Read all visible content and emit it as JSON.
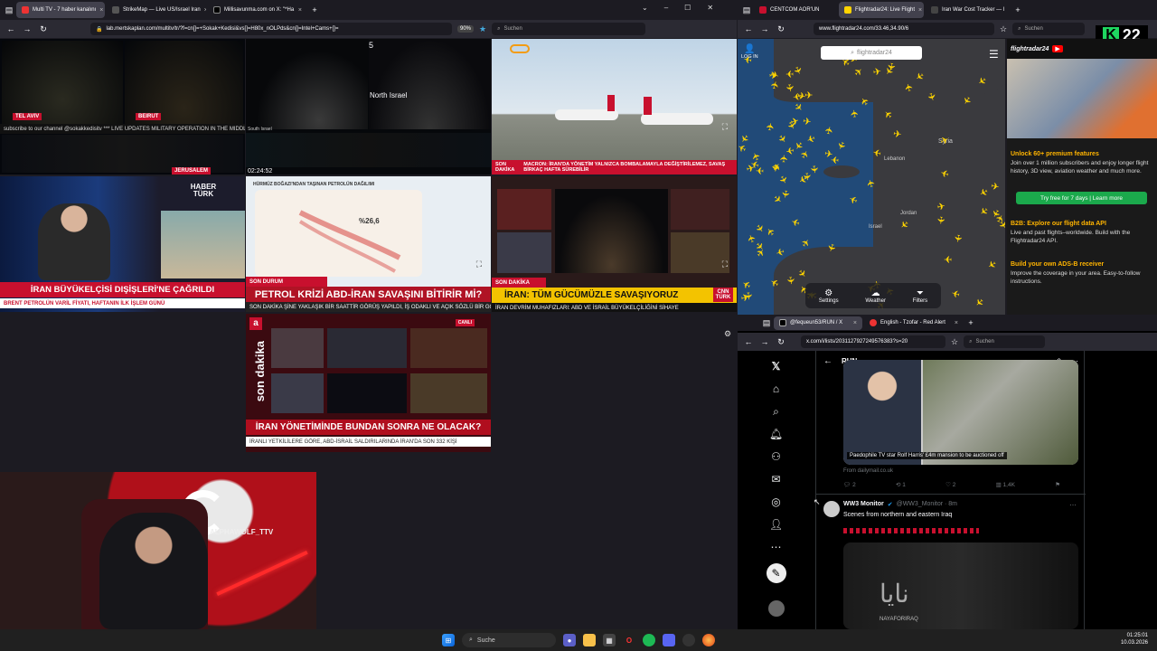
{
  "left_browser": {
    "tabs": [
      {
        "label": "Multi TV - 7 haber kanalını",
        "active": true
      },
      {
        "label": "StrikeMap — Live US/Israel Iran",
        "active": false
      },
      {
        "label": "Millisavunma.com on X: \"*Ha",
        "active": false
      }
    ],
    "url": "lab.mertskaplan.com/multitv/tr/?f=cn[]=+Sokak+Kedisi&vs[]=H80x_nOLPds&cn[]=Intel+Cams+[]=",
    "zoom": "90%",
    "search_placeholder": "Suchen"
  },
  "tiles": {
    "telaviv_label": "TEL AVIV",
    "beirut_label": "BEIRUT",
    "jerusalem_label": "JERUSALEM",
    "tiles_ticker": "subscribe to our channel @sokakkedisitv  *** LIVE UPDATES MILITARY OPERATION IN THE MIDDLE EAST",
    "north_israel": "North Israel",
    "south_israel": "South Israel",
    "cam_number": "5",
    "clock": "02:24:52",
    "ntv_ticker": "MACRON: İRAN'DA YÖNETİM YALNIZCA BOMBALAMAYLA DEĞİŞTİRİLEMEZ, SAVAŞ BİRKAÇ HAFTA SÜREBİLİR",
    "son_dakika": "SON DAKİKA",
    "haberturk_logo": "HABER TÜRK",
    "haberturk_headline": "İRAN BÜYÜKELÇİSİ DIŞİŞLERİ'NE ÇAĞRILDI",
    "haberturk_ticker": "BRENT PETROLÜN VARİL FİYATI, HAFTANIN İLK İŞLEM GÜNÜ",
    "map_title": "HÜRMÜZ BOĞAZI'NDAN TAŞINAN PETROLÜN DAĞILIMI",
    "map_percent": "%26,6",
    "son_durum": "SON DURUM",
    "petrol_headline": "PETROL KRİZİ ABD-İRAN SAVAŞINI BİTİRİR Mİ?",
    "petrol_ticker": "SON DAKİKA  ŞİNE YAKLAŞIK BİR SAATTİR GÖRÜŞ YAPILDI, İŞ ODAKLI VE AÇIK SÖZLÜ BİR GÖRÜŞME",
    "cnn_headline": "İRAN: TÜM GÜCÜMÜZLE SAVAŞIYORUZ",
    "cnn_logo": "CNN TÜRK",
    "cnn_ticker": "İRAN DEVRİM MUHAFIZLARI: ABD VE İSRAİL BÜYÜKELÇİLİĞİNİ SİHAYE",
    "canli": "CANLI",
    "a_haber_headline": "İRAN YÖNETİMİNDE BUNDAN SONRA NE OLACAK?",
    "a_haber_ticker": "İRANLI YETKİLİLERE GÖRE, ABD-İSRAİL SALDIRILARINDA İRAN'DA SON 332 KİŞİ",
    "son_dakika_side": "son dakika",
    "streamer_tag": "ALPHAWOLF_TTV"
  },
  "right_top_browser": {
    "tabs": [
      {
        "label": "CENTCOM AOR'UN",
        "active": false
      },
      {
        "label": "Flightradar24: Live Flight",
        "active": true
      },
      {
        "label": "Iran War Cost Tracker — l",
        "active": false
      }
    ],
    "url": "www.flightradar24.com/33.46,34.90/6",
    "search_placeholder": "Suchen",
    "login": "LOG IN",
    "fr24_search": "flightradar24",
    "map_labels": [
      "Syria",
      "Lebanon",
      "Israel",
      "Jordan"
    ],
    "bottom_buttons": [
      "Settings",
      "Weather",
      "Filters"
    ],
    "k22": "22",
    "promo": [
      {
        "title": "Unlock 60+ premium features",
        "text": "Join over 1 million subscribers and enjoy longer flight history, 3D view, aviation weather and much more."
      },
      {
        "title": "B2B: Explore our flight data API",
        "text": "Live and past flights–worldwide. Build with the Flightradar24 API."
      },
      {
        "title": "Build your own ADS-B receiver",
        "text": "Improve the coverage in your area. Easy-to-follow instructions."
      }
    ],
    "trial_button": "Try free for 7 days | Learn more"
  },
  "right_bottom_browser": {
    "tabs": [
      {
        "label": "@fequeun53/RUN / X",
        "active": true
      },
      {
        "label": "English - Tzofar - Red Alert",
        "active": false
      }
    ],
    "url": "x.com/i/lists/2031127927249576383?s=20",
    "search_placeholder": "Suchen",
    "list_title": "RUN",
    "post1": {
      "caption": "Paedophile TV star Rolf Harris' £4m mansion to be auctioned off",
      "source": "From dailymail.co.uk",
      "replies": "2",
      "reposts": "1",
      "likes": "2",
      "views": "1,4K"
    },
    "post2": {
      "author": "WW3 Monitor",
      "handle": "@WW3_Monitor · 8m",
      "text": "Scenes from northern and eastern Iraq",
      "video_text": "نايا",
      "video_sub": "NAYAFORIRAQ"
    }
  },
  "taskbar": {
    "search": "Suche",
    "time": "01:25:01",
    "date": "10.03.2026"
  },
  "colors": {
    "accent_red": "#c8102e",
    "fr24_yellow": "#ffd400",
    "browser_bg": "#1c1b22",
    "toolbar_bg": "#2b2a33"
  }
}
